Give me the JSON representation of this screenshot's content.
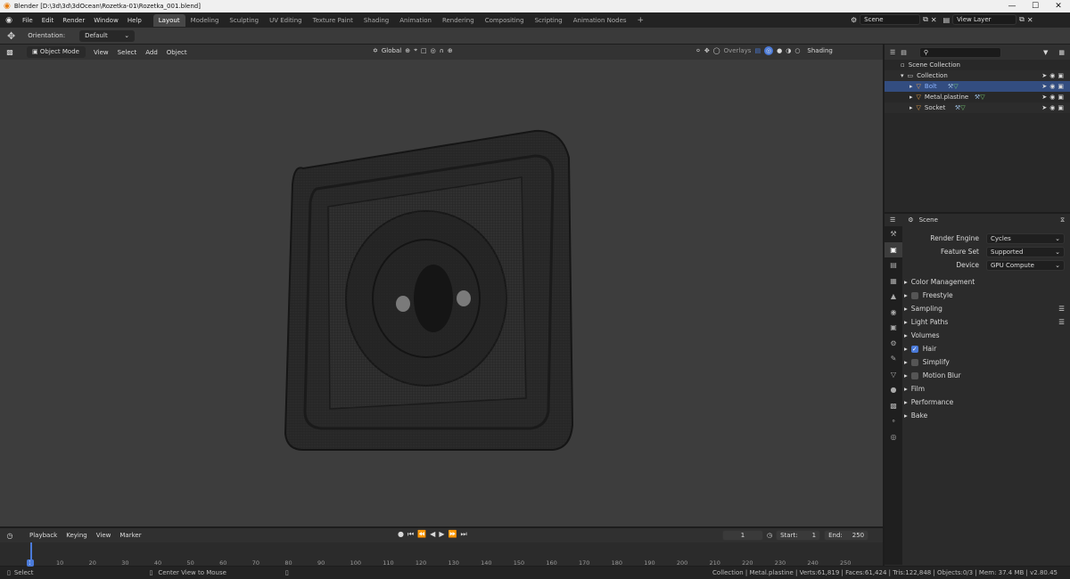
{
  "window": {
    "title": "Blender [D:\\3d\\3d\\3dOcean\\Rozetka-01\\Rozetka_001.blend]",
    "controls": [
      "—",
      "☐",
      "✕"
    ]
  },
  "menus": [
    "File",
    "Edit",
    "Render",
    "Window",
    "Help"
  ],
  "workspaces": [
    "Layout",
    "Modeling",
    "Sculpting",
    "UV Editing",
    "Texture Paint",
    "Shading",
    "Animation",
    "Rendering",
    "Compositing",
    "Scripting",
    "Animation Nodes"
  ],
  "add_workspace": "+",
  "scene": {
    "name": "Scene",
    "view_layer": "View Layer"
  },
  "toolbar": {
    "orientation_label": "Orientation:",
    "orientation_value": "Default"
  },
  "viewport_header": {
    "mode": "Object Mode",
    "menus": [
      "View",
      "Select",
      "Add",
      "Object"
    ],
    "transform": "Global",
    "overlays": "Overlays",
    "shading": "Shading"
  },
  "outliner": {
    "search_placeholder": "",
    "root": "Scene Collection",
    "collection": "Collection",
    "items": [
      {
        "name": "Bolt",
        "selected": true
      },
      {
        "name": "Metal.plastine",
        "selected": false
      },
      {
        "name": "Socket",
        "selected": false
      }
    ]
  },
  "properties": {
    "context": "Scene",
    "fields": [
      {
        "label": "Render Engine",
        "value": "Cycles"
      },
      {
        "label": "Feature Set",
        "value": "Supported"
      },
      {
        "label": "Device",
        "value": "GPU Compute"
      }
    ],
    "panels": [
      {
        "label": "Color Management",
        "checkbox": null,
        "list_icon": false
      },
      {
        "label": "Freestyle",
        "checkbox": false,
        "list_icon": false
      },
      {
        "label": "Sampling",
        "checkbox": null,
        "list_icon": true
      },
      {
        "label": "Light Paths",
        "checkbox": null,
        "list_icon": true
      },
      {
        "label": "Volumes",
        "checkbox": null,
        "list_icon": false
      },
      {
        "label": "Hair",
        "checkbox": true,
        "list_icon": false
      },
      {
        "label": "Simplify",
        "checkbox": false,
        "list_icon": false
      },
      {
        "label": "Motion Blur",
        "checkbox": false,
        "list_icon": false
      },
      {
        "label": "Film",
        "checkbox": null,
        "list_icon": false
      },
      {
        "label": "Performance",
        "checkbox": null,
        "list_icon": false
      },
      {
        "label": "Bake",
        "checkbox": null,
        "list_icon": false
      }
    ]
  },
  "timeline": {
    "menus": [
      "Playback",
      "Keying",
      "View",
      "Marker"
    ],
    "current_frame": "1",
    "start_label": "Start:",
    "start": "1",
    "end_label": "End:",
    "end": "250",
    "ticks": [
      "1",
      "10",
      "20",
      "30",
      "40",
      "50",
      "60",
      "70",
      "80",
      "90",
      "100",
      "110",
      "120",
      "130",
      "140",
      "150",
      "160",
      "170",
      "180",
      "190",
      "200",
      "210",
      "220",
      "230",
      "240",
      "250"
    ]
  },
  "status": {
    "left_action": "Select",
    "mid_action": "Center View to Mouse",
    "stats": "Collection | Metal.plastine | Verts:61,819 | Faces:61,424 | Tris:122,848 | Objects:0/3 | Mem: 37.4 MB | v2.80.45"
  },
  "colors": {
    "accent": "#4a7ad9",
    "selection": "#334d80",
    "viewport_bg": "#3d3d3d",
    "logo": "#e87d0d"
  }
}
